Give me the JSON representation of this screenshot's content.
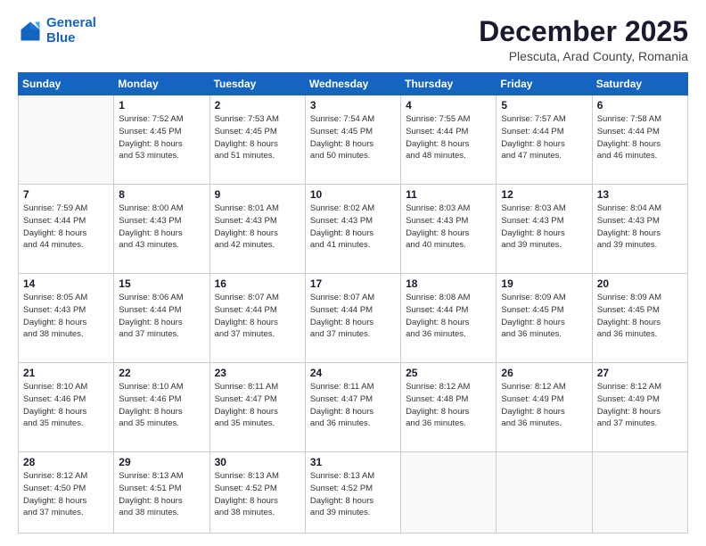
{
  "header": {
    "logo_line1": "General",
    "logo_line2": "Blue",
    "title": "December 2025",
    "subtitle": "Plescuta, Arad County, Romania"
  },
  "weekdays": [
    "Sunday",
    "Monday",
    "Tuesday",
    "Wednesday",
    "Thursday",
    "Friday",
    "Saturday"
  ],
  "weeks": [
    [
      {
        "day": "",
        "info": ""
      },
      {
        "day": "1",
        "info": "Sunrise: 7:52 AM\nSunset: 4:45 PM\nDaylight: 8 hours\nand 53 minutes."
      },
      {
        "day": "2",
        "info": "Sunrise: 7:53 AM\nSunset: 4:45 PM\nDaylight: 8 hours\nand 51 minutes."
      },
      {
        "day": "3",
        "info": "Sunrise: 7:54 AM\nSunset: 4:45 PM\nDaylight: 8 hours\nand 50 minutes."
      },
      {
        "day": "4",
        "info": "Sunrise: 7:55 AM\nSunset: 4:44 PM\nDaylight: 8 hours\nand 48 minutes."
      },
      {
        "day": "5",
        "info": "Sunrise: 7:57 AM\nSunset: 4:44 PM\nDaylight: 8 hours\nand 47 minutes."
      },
      {
        "day": "6",
        "info": "Sunrise: 7:58 AM\nSunset: 4:44 PM\nDaylight: 8 hours\nand 46 minutes."
      }
    ],
    [
      {
        "day": "7",
        "info": "Sunrise: 7:59 AM\nSunset: 4:44 PM\nDaylight: 8 hours\nand 44 minutes."
      },
      {
        "day": "8",
        "info": "Sunrise: 8:00 AM\nSunset: 4:43 PM\nDaylight: 8 hours\nand 43 minutes."
      },
      {
        "day": "9",
        "info": "Sunrise: 8:01 AM\nSunset: 4:43 PM\nDaylight: 8 hours\nand 42 minutes."
      },
      {
        "day": "10",
        "info": "Sunrise: 8:02 AM\nSunset: 4:43 PM\nDaylight: 8 hours\nand 41 minutes."
      },
      {
        "day": "11",
        "info": "Sunrise: 8:03 AM\nSunset: 4:43 PM\nDaylight: 8 hours\nand 40 minutes."
      },
      {
        "day": "12",
        "info": "Sunrise: 8:03 AM\nSunset: 4:43 PM\nDaylight: 8 hours\nand 39 minutes."
      },
      {
        "day": "13",
        "info": "Sunrise: 8:04 AM\nSunset: 4:43 PM\nDaylight: 8 hours\nand 39 minutes."
      }
    ],
    [
      {
        "day": "14",
        "info": "Sunrise: 8:05 AM\nSunset: 4:43 PM\nDaylight: 8 hours\nand 38 minutes."
      },
      {
        "day": "15",
        "info": "Sunrise: 8:06 AM\nSunset: 4:44 PM\nDaylight: 8 hours\nand 37 minutes."
      },
      {
        "day": "16",
        "info": "Sunrise: 8:07 AM\nSunset: 4:44 PM\nDaylight: 8 hours\nand 37 minutes."
      },
      {
        "day": "17",
        "info": "Sunrise: 8:07 AM\nSunset: 4:44 PM\nDaylight: 8 hours\nand 37 minutes."
      },
      {
        "day": "18",
        "info": "Sunrise: 8:08 AM\nSunset: 4:44 PM\nDaylight: 8 hours\nand 36 minutes."
      },
      {
        "day": "19",
        "info": "Sunrise: 8:09 AM\nSunset: 4:45 PM\nDaylight: 8 hours\nand 36 minutes."
      },
      {
        "day": "20",
        "info": "Sunrise: 8:09 AM\nSunset: 4:45 PM\nDaylight: 8 hours\nand 36 minutes."
      }
    ],
    [
      {
        "day": "21",
        "info": "Sunrise: 8:10 AM\nSunset: 4:46 PM\nDaylight: 8 hours\nand 35 minutes."
      },
      {
        "day": "22",
        "info": "Sunrise: 8:10 AM\nSunset: 4:46 PM\nDaylight: 8 hours\nand 35 minutes."
      },
      {
        "day": "23",
        "info": "Sunrise: 8:11 AM\nSunset: 4:47 PM\nDaylight: 8 hours\nand 35 minutes."
      },
      {
        "day": "24",
        "info": "Sunrise: 8:11 AM\nSunset: 4:47 PM\nDaylight: 8 hours\nand 36 minutes."
      },
      {
        "day": "25",
        "info": "Sunrise: 8:12 AM\nSunset: 4:48 PM\nDaylight: 8 hours\nand 36 minutes."
      },
      {
        "day": "26",
        "info": "Sunrise: 8:12 AM\nSunset: 4:49 PM\nDaylight: 8 hours\nand 36 minutes."
      },
      {
        "day": "27",
        "info": "Sunrise: 8:12 AM\nSunset: 4:49 PM\nDaylight: 8 hours\nand 37 minutes."
      }
    ],
    [
      {
        "day": "28",
        "info": "Sunrise: 8:12 AM\nSunset: 4:50 PM\nDaylight: 8 hours\nand 37 minutes."
      },
      {
        "day": "29",
        "info": "Sunrise: 8:13 AM\nSunset: 4:51 PM\nDaylight: 8 hours\nand 38 minutes."
      },
      {
        "day": "30",
        "info": "Sunrise: 8:13 AM\nSunset: 4:52 PM\nDaylight: 8 hours\nand 38 minutes."
      },
      {
        "day": "31",
        "info": "Sunrise: 8:13 AM\nSunset: 4:52 PM\nDaylight: 8 hours\nand 39 minutes."
      },
      {
        "day": "",
        "info": ""
      },
      {
        "day": "",
        "info": ""
      },
      {
        "day": "",
        "info": ""
      }
    ]
  ]
}
